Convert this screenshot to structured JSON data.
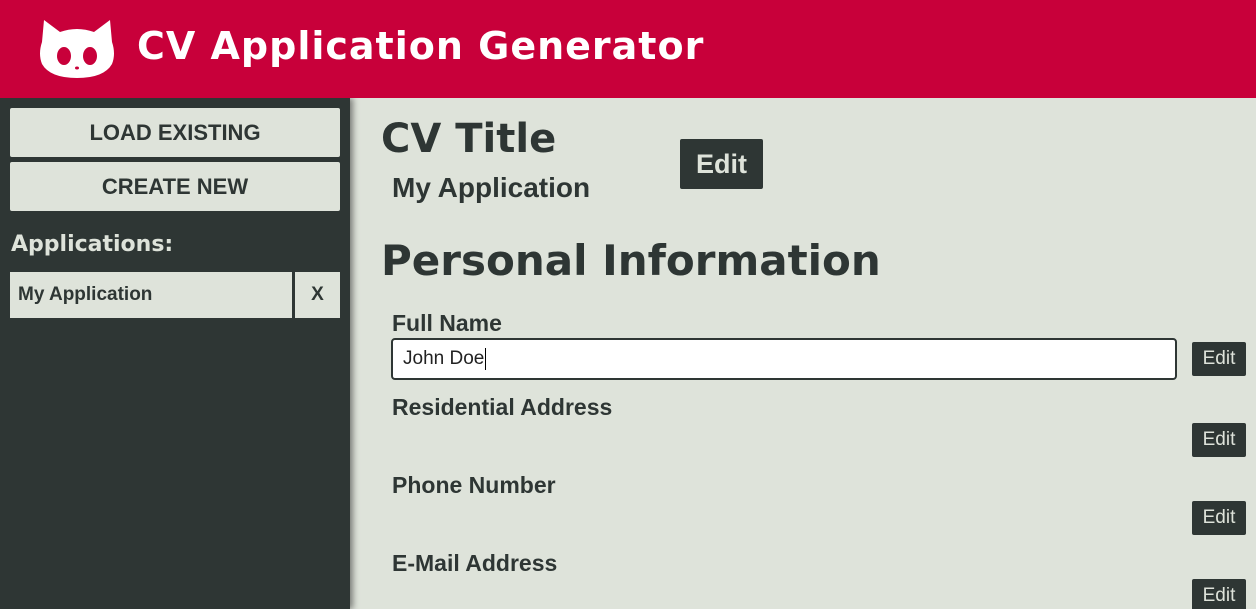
{
  "header": {
    "title": "CV Application Generator",
    "logo_icon": "github-octocat-icon",
    "background": "#c8003a"
  },
  "sidebar": {
    "load_label": "LOAD EXISTING",
    "create_label": "CREATE NEW",
    "applications_heading": "Applications:",
    "applications": [
      {
        "name": "My Application",
        "delete_label": "X"
      }
    ],
    "background": "#2e3634"
  },
  "main": {
    "cv_title_heading": "CV Title",
    "cv_title_value": "My Application",
    "cv_title_edit_label": "Edit",
    "personal_heading": "Personal Information",
    "fields": [
      {
        "label": "Full Name",
        "value": "John Doe",
        "edit_label": "Edit"
      },
      {
        "label": "Residential Address",
        "value": "",
        "edit_label": "Edit"
      },
      {
        "label": "Phone Number",
        "value": "",
        "edit_label": "Edit"
      },
      {
        "label": "E-Mail Address",
        "value": "",
        "edit_label": "Edit"
      }
    ],
    "background": "#dee3da"
  }
}
